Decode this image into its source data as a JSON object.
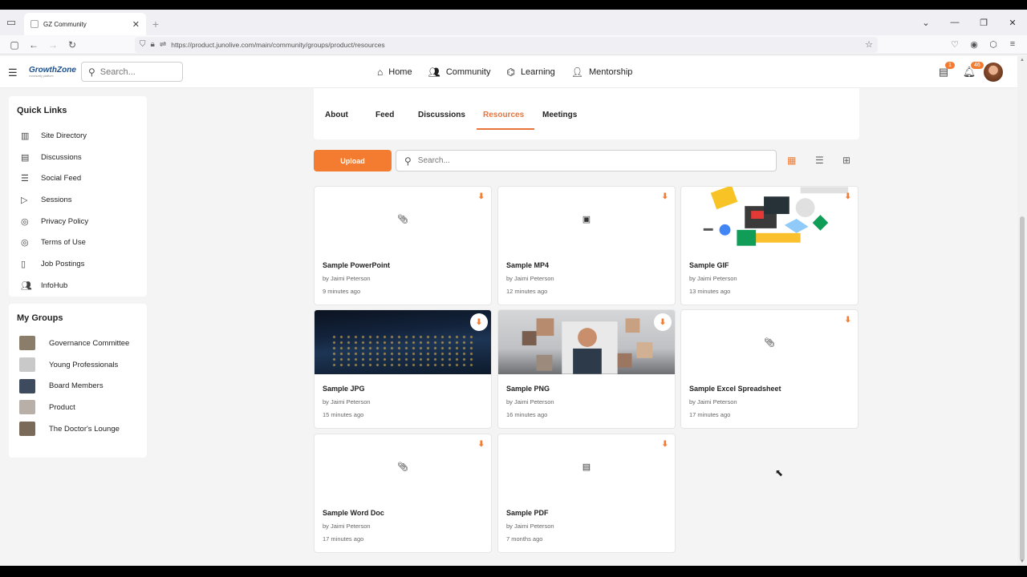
{
  "browser": {
    "tab_title": "GZ Community",
    "url": "https://product.junolive.com/main/community/groups/product/resources"
  },
  "header": {
    "logo": "GrowthZone",
    "logo_sub": "community platform",
    "search_placeholder": "Search...",
    "nav": [
      {
        "label": "Home",
        "icon": "home-icon"
      },
      {
        "label": "Community",
        "icon": "people-icon"
      },
      {
        "label": "Learning",
        "icon": "graduation-cap-icon"
      },
      {
        "label": "Mentorship",
        "icon": "mentorship-icon"
      }
    ],
    "messages_badge": "1",
    "notifications_badge": "46"
  },
  "quick_links": {
    "title": "Quick Links",
    "items": [
      {
        "label": "Site Directory",
        "icon": "directory-icon"
      },
      {
        "label": "Discussions",
        "icon": "chat-icon"
      },
      {
        "label": "Social Feed",
        "icon": "feed-icon"
      },
      {
        "label": "Sessions",
        "icon": "play-icon"
      },
      {
        "label": "Privacy Policy",
        "icon": "policy-icon"
      },
      {
        "label": "Terms of Use",
        "icon": "terms-icon"
      },
      {
        "label": "Job Postings",
        "icon": "job-icon"
      },
      {
        "label": "InfoHub",
        "icon": "group-icon"
      }
    ]
  },
  "my_groups": {
    "title": "My Groups",
    "items": [
      {
        "label": "Governance Committee",
        "color": "#8a7d6a"
      },
      {
        "label": "Young Professionals",
        "color": "#c9c9c9"
      },
      {
        "label": "Board Members",
        "color": "#3e4a5e"
      },
      {
        "label": "Product",
        "color": "#b8b0a8"
      },
      {
        "label": "The Doctor's Lounge",
        "color": "#7a6a5a"
      }
    ]
  },
  "group_tabs": [
    "About",
    "Feed",
    "Discussions",
    "Resources",
    "Meetings"
  ],
  "active_tab": "Resources",
  "resources": {
    "upload_label": "Upload",
    "search_placeholder": "Search...",
    "items": [
      {
        "title": "Sample PowerPoint",
        "by": "by Jaimi Peterson",
        "time": "9 minutes ago",
        "thumb": "paperclip-icon"
      },
      {
        "title": "Sample MP4",
        "by": "by Jaimi Peterson",
        "time": "12 minutes ago",
        "thumb": "video-file-icon"
      },
      {
        "title": "Sample GIF",
        "by": "by Jaimi Peterson",
        "time": "13 minutes ago",
        "thumb": "gif-illustration"
      },
      {
        "title": "Sample JPG",
        "by": "by Jaimi Peterson",
        "time": "15 minutes ago",
        "thumb": "earth-photo"
      },
      {
        "title": "Sample PNG",
        "by": "by Jaimi Peterson",
        "time": "16 minutes ago",
        "thumb": "video-call-photo"
      },
      {
        "title": "Sample Excel Spreadsheet",
        "by": "by Jaimi Peterson",
        "time": "17 minutes ago",
        "thumb": "paperclip-icon"
      },
      {
        "title": "Sample Word Doc",
        "by": "by Jaimi Peterson",
        "time": "17 minutes ago",
        "thumb": "paperclip-icon"
      },
      {
        "title": "Sample PDF",
        "by": "by Jaimi Peterson",
        "time": "7 months ago",
        "thumb": "pdf-file-icon"
      }
    ]
  },
  "colors": {
    "accent": "#f47c30",
    "brand": "#1e4f8a"
  }
}
